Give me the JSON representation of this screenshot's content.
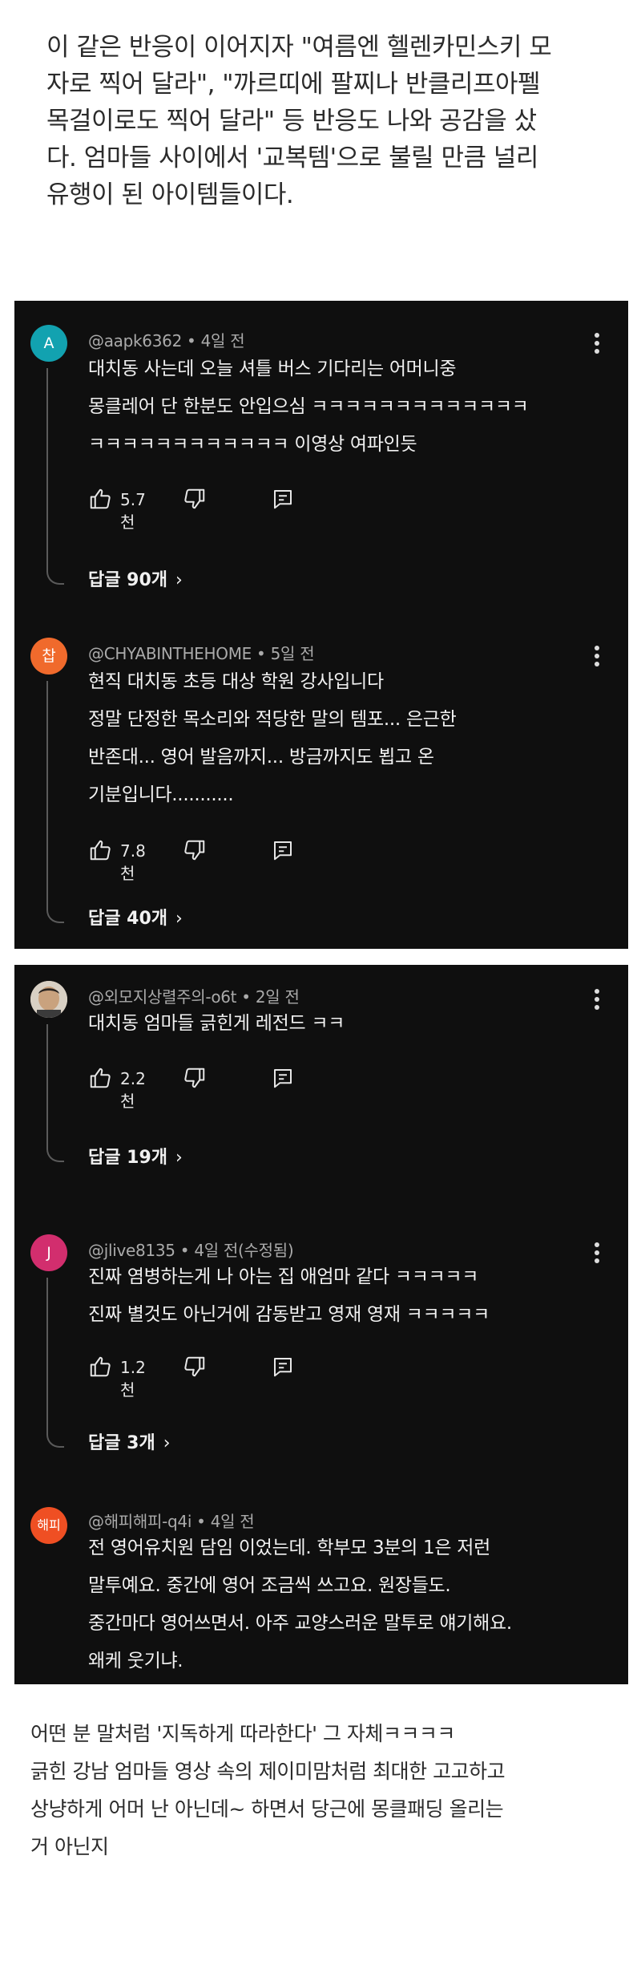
{
  "article": {
    "intro": "이 같은 반응이 이어지자 \"여름엔 헬렌카민스키 모\n자로 찍어 달라\", \"까르띠에 팔찌나 반클리프아펠\n목걸이로도 찍어 달라\" 등 반응도 나와 공감을 샀\n다. 엄마들 사이에서 '교복템'으로 불릴 만큼 널리\n유행이 된 아이템들이다.",
    "outro": "어떤 분 말처럼 '지독하게 따라한다' 그 자체ㅋㅋㅋㅋ\n긁힌 강남 엄마들 영상 속의 제이미맘처럼 최대한 고고하고\n상냥하게 어머 난 아닌데~ 하면서 당근에 몽클패딩 올리는\n거 아닌지"
  },
  "panel1": {
    "comments": [
      {
        "avatar_text": "A",
        "avatar_color": "#12a2b0",
        "handle": "@aapk6362",
        "time": "4일 전",
        "lines": [
          "대치동 사는데 오늘 셔틀 버스 기다리는 어머니중",
          "몽클레어 단 한분도 안입으심 ㅋㅋㅋㅋㅋㅋㅋㅋㅋㅋㅋㅋㅋ",
          "ㅋㅋㅋㅋㅋㅋㅋㅋㅋㅋㅋㅋ 이영상 여파인듯"
        ],
        "likes": "5.7천",
        "replies": "답글 90개"
      },
      {
        "avatar_text": "찹",
        "avatar_color": "#f06a2c",
        "handle": "@CHYABINTHEHOME",
        "time": "5일 전",
        "lines": [
          "현직 대치동 초등 대상 학원 강사입니다",
          "정말 단정한 목소리와 적당한 말의 템포... 은근한",
          "반존대... 영어 발음까지... 방금까지도 뵙고 온",
          "기분입니다..........."
        ],
        "likes": "7.8천",
        "replies": "답글 40개"
      }
    ]
  },
  "panel2": {
    "comments": [
      {
        "avatar_text": "",
        "avatar_color": "#cfc6b8",
        "handle": "@외모지상렬주의-o6t",
        "time": "2일 전",
        "lines": [
          "대치동 엄마들 긁힌게 레전드 ㅋㅋ"
        ],
        "likes": "2.2천",
        "replies": "답글 19개"
      },
      {
        "avatar_text": "J",
        "avatar_color": "#d22e6e",
        "handle": "@jlive8135",
        "time": "4일 전(수정됨)",
        "lines": [
          "진짜 염병하는게 나 아는 집 애엄마 같다 ㅋㅋㅋㅋㅋ",
          "진짜 별것도 아닌거에 감동받고 영재 영재 ㅋㅋㅋㅋㅋ"
        ],
        "likes": "1.2천",
        "replies": "답글 3개"
      },
      {
        "avatar_text": "해피",
        "avatar_color": "#ef4f23",
        "handle": "@해피해피-q4i",
        "time": "4일 전",
        "lines": [
          "전 영어유치원 담임 이었는데. 학부모 3분의 1은 저런",
          "말투예요. 중간에 영어 조금씩 쓰고요. 원장들도.",
          "중간마다 영어쓰면서. 아주 교양스러운 말투로 얘기해요.",
          "왜케 웃기냐."
        ]
      }
    ]
  },
  "icons": {
    "like": "thumbs-up-icon",
    "dislike": "thumbs-down-icon",
    "reply": "reply-icon",
    "more": "more-vertical-icon",
    "chevron": "chevron-right-icon"
  },
  "meta_separator": " • ",
  "chevron_glyph": "›"
}
